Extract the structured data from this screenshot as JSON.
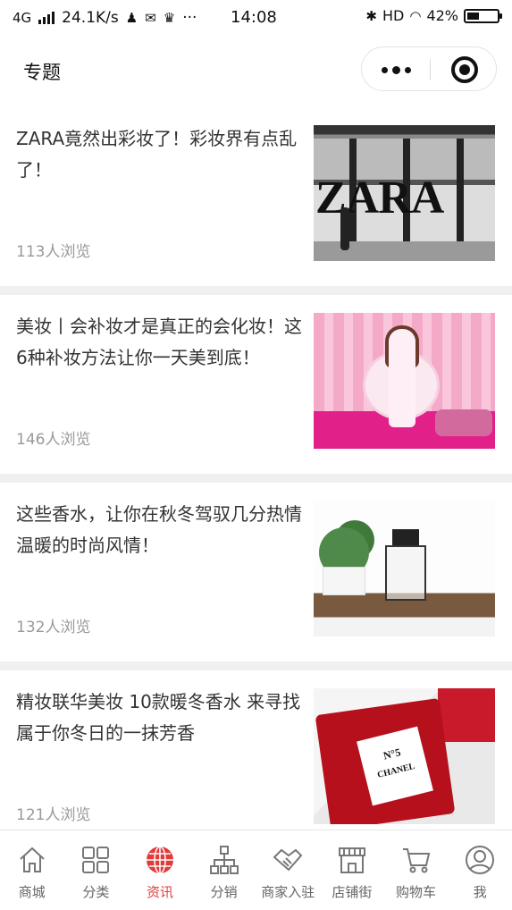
{
  "status_bar": {
    "network": "4G",
    "speed": "24.1K/s",
    "dots": "···",
    "time": "14:08",
    "hd": "HD",
    "battery_text": "42%",
    "battery_level": 0.42
  },
  "header": {
    "title": "专题"
  },
  "articles": [
    {
      "title": "ZARA竟然出彩妆了！彩妆界有点乱了！",
      "views": "113人浏览",
      "image": "zara-storefront",
      "image_text": "ZARA"
    },
    {
      "title": "美妆丨会补妆才是真正的会化妆！这6种补妆方法让你一天美到底！",
      "views": "146人浏览",
      "image": "pink-studio-woman"
    },
    {
      "title": "这些香水，让你在秋冬驾驭几分热情温暖的时尚风情！",
      "views": "132人浏览",
      "image": "perfume-on-shelf"
    },
    {
      "title": "精妆联华美妆 10款暖冬香水 来寻找属于你冬日的一抹芳香",
      "views": "121人浏览",
      "image": "chanel-no5-red",
      "image_label_top": "N°5",
      "image_label_brand": "CHANEL"
    }
  ],
  "tabbar": {
    "active_color": "#e23b3b",
    "items": [
      {
        "label": "商城",
        "icon": "home-icon"
      },
      {
        "label": "分类",
        "icon": "grid-icon"
      },
      {
        "label": "资讯",
        "icon": "globe-icon",
        "active": true
      },
      {
        "label": "分销",
        "icon": "org-chart-icon"
      },
      {
        "label": "商家入驻",
        "icon": "handshake-icon"
      },
      {
        "label": "店铺街",
        "icon": "storefront-icon"
      },
      {
        "label": "购物车",
        "icon": "cart-icon"
      },
      {
        "label": "我",
        "icon": "user-icon"
      }
    ]
  }
}
